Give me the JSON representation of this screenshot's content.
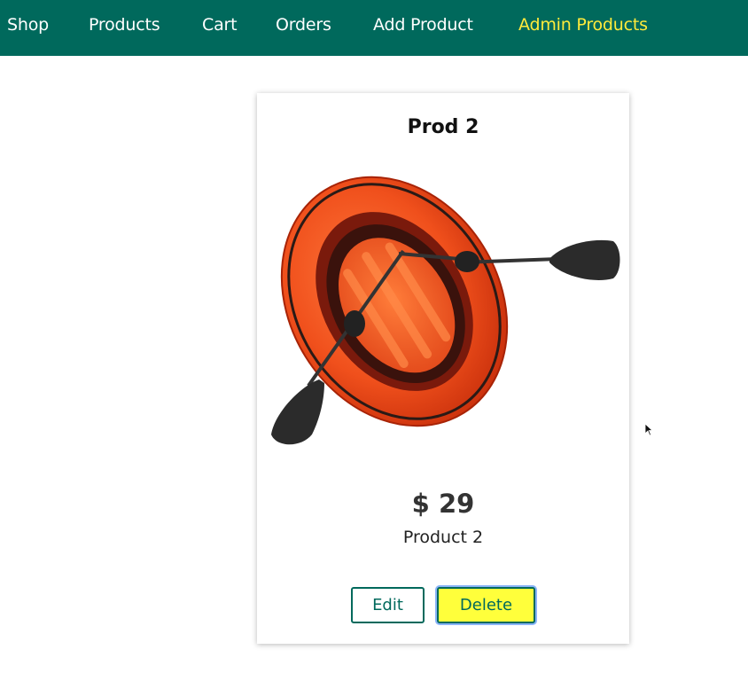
{
  "nav": {
    "items": [
      {
        "label": "Shop"
      },
      {
        "label": "Products"
      },
      {
        "label": "Cart"
      },
      {
        "label": "Orders"
      },
      {
        "label": "Add Product"
      },
      {
        "label": "Admin Products",
        "active": true
      }
    ],
    "active_color": "#ffeb3b",
    "background": "#00695c"
  },
  "product": {
    "title": "Prod 2",
    "image_icon": "inflatable-boat-image",
    "price": "$ 29",
    "description": "Product 2",
    "edit_label": "Edit",
    "delete_label": "Delete",
    "delete_color": "#ffff3b"
  }
}
